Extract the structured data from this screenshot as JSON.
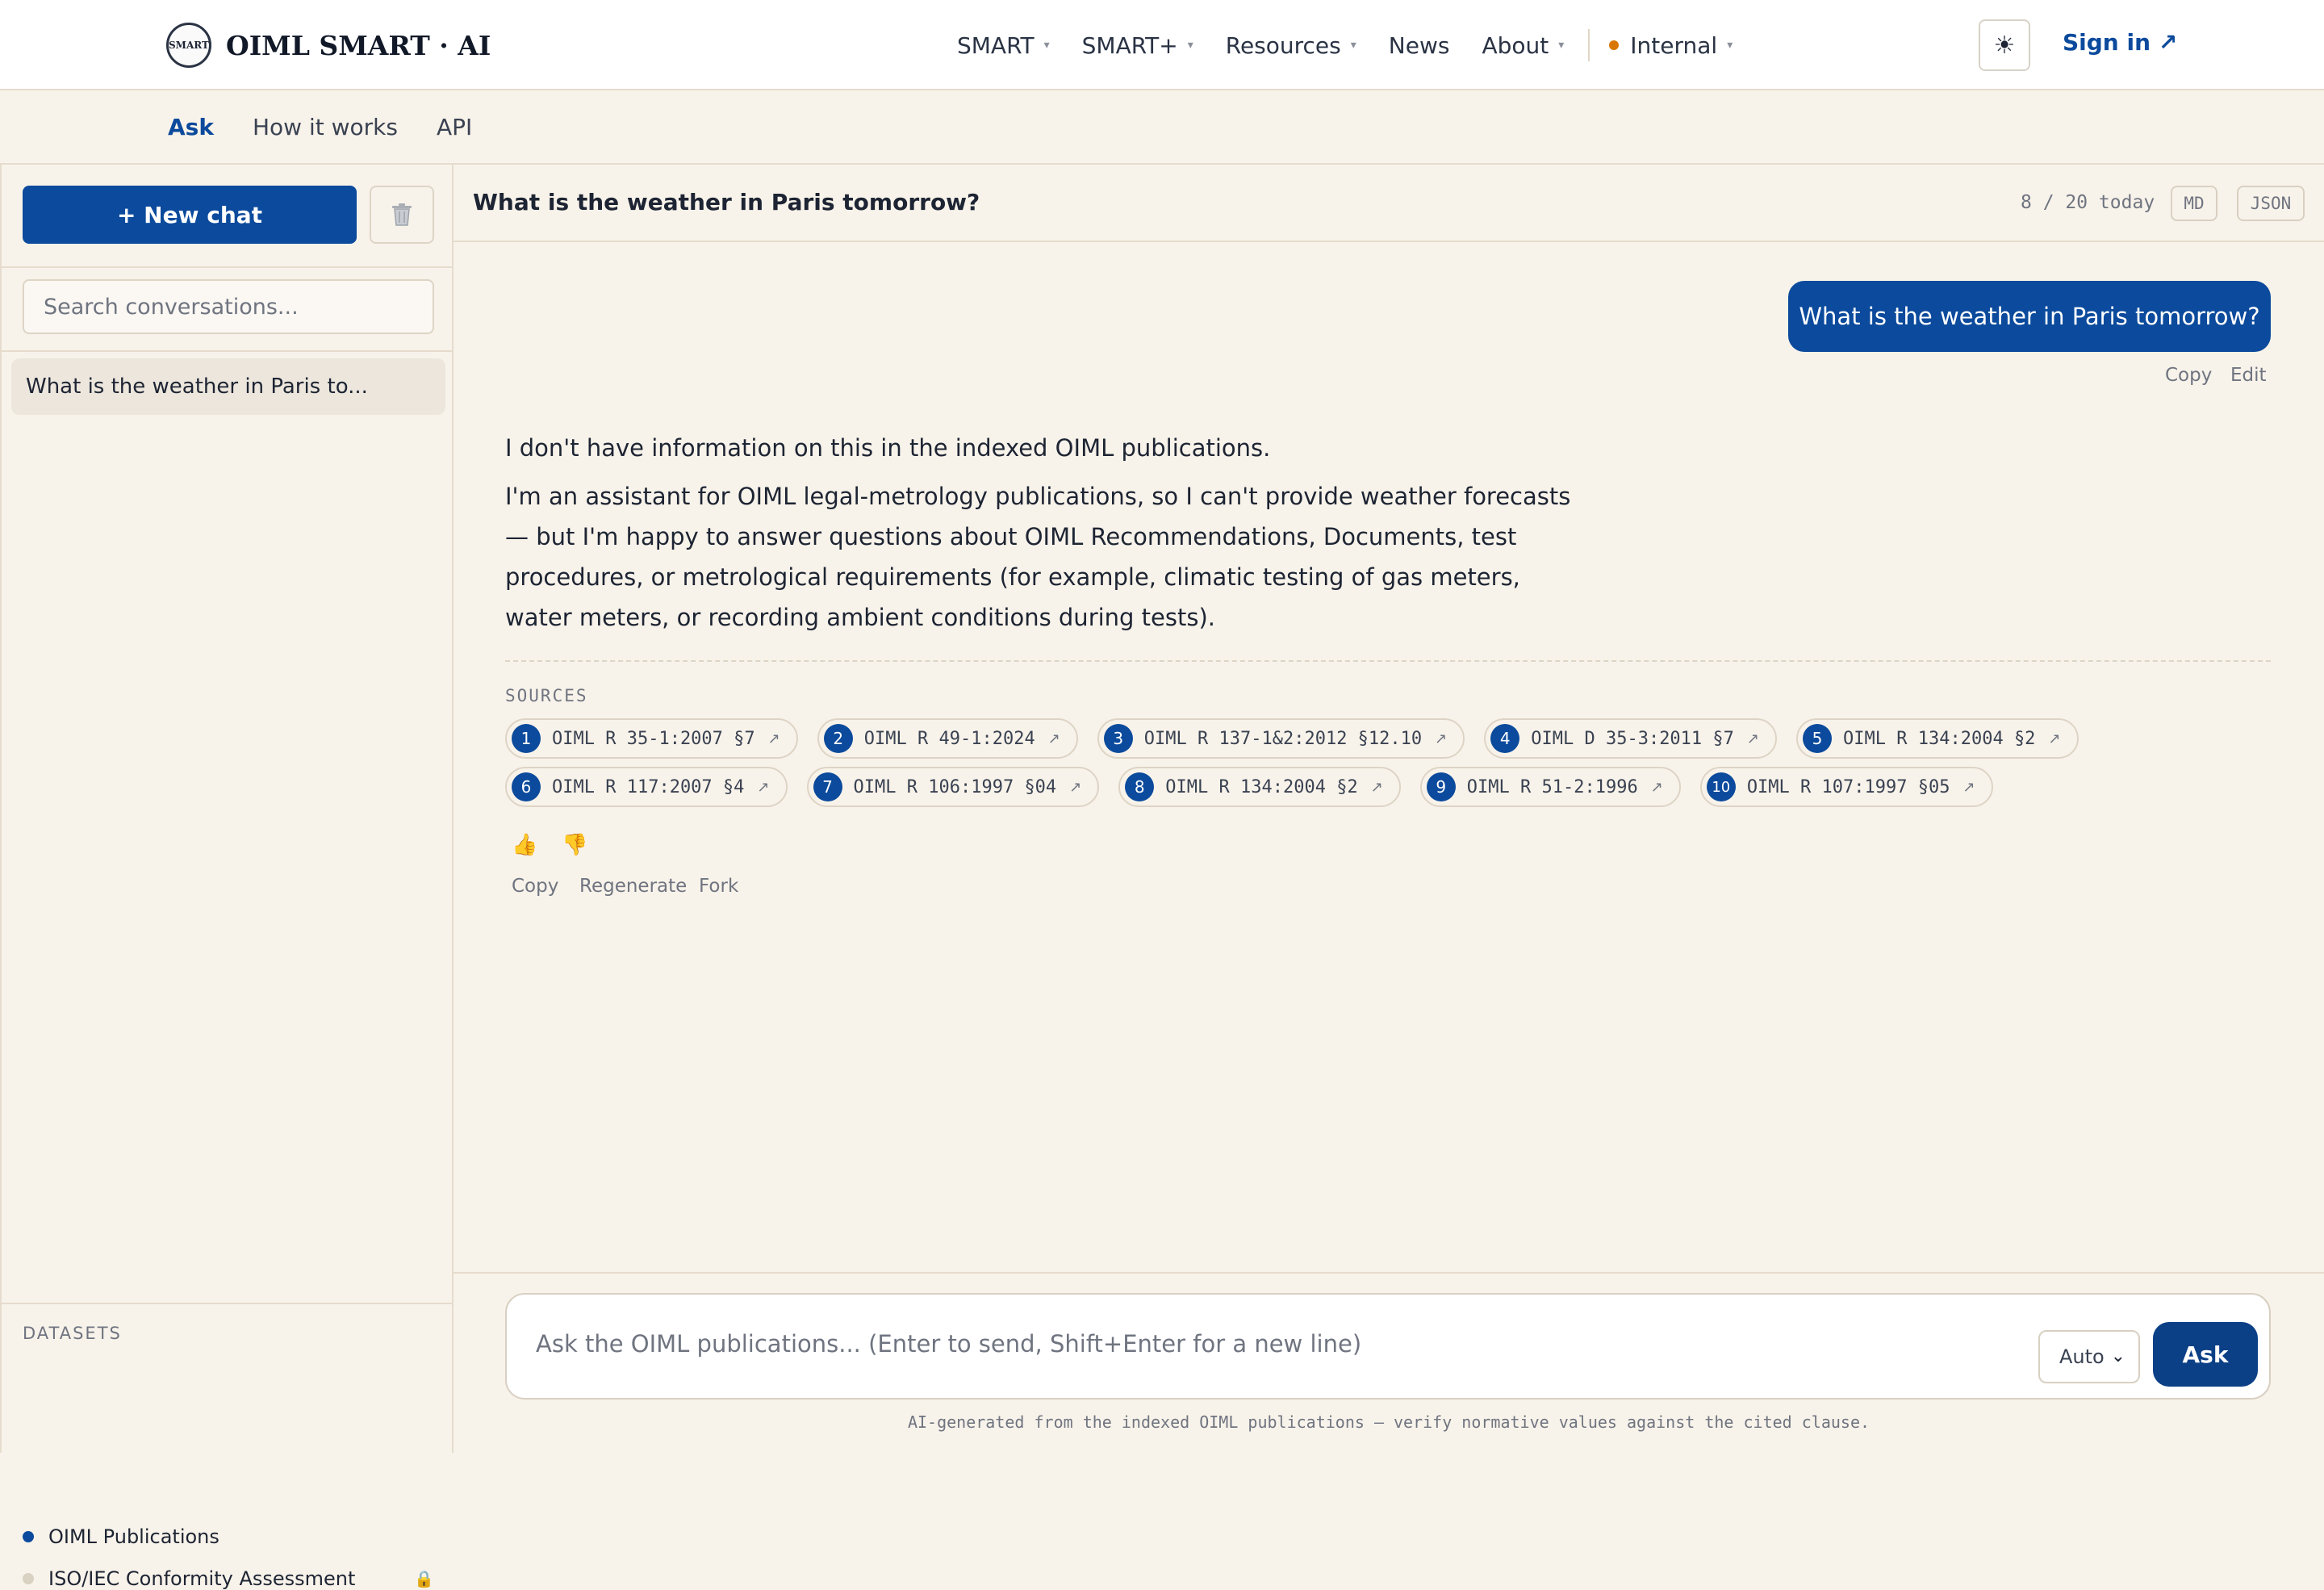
{
  "brand": {
    "logo_text": "SMART",
    "name": "OIML SMART · AI"
  },
  "nav": {
    "items": [
      {
        "label": "SMART",
        "has_caret": true
      },
      {
        "label": "SMART+",
        "has_caret": true
      },
      {
        "label": "Resources",
        "has_caret": true
      },
      {
        "label": "News",
        "has_caret": false
      },
      {
        "label": "About",
        "has_caret": true
      }
    ],
    "internal_label": "Internal",
    "theme_icon": "sun-icon",
    "sign_in": "Sign in ↗"
  },
  "subnav": {
    "tabs": [
      "Ask",
      "How it works",
      "API"
    ],
    "active": "Ask"
  },
  "sidebar": {
    "new_chat": "+ New chat",
    "search_placeholder": "Search conversations...",
    "conversations": [
      "What is the weather in Paris to..."
    ],
    "datasets_title": "DATASETS",
    "datasets": [
      {
        "name": "OIML Publications",
        "color": "#0b4a9c",
        "locked": false
      },
      {
        "name": "ISO/IEC Conformity Assessment",
        "color": "#d9d2c2",
        "locked": true
      }
    ]
  },
  "chat": {
    "title": "What is the weather in Paris tomorrow?",
    "quota": "8 / 20 today",
    "export_md": "MD",
    "export_json": "JSON",
    "user_message": "What is the weather in Paris tomorrow?",
    "user_actions": {
      "copy": "Copy",
      "edit": "Edit"
    },
    "answer_paragraphs": [
      "I don't have information on this in the indexed OIML publications.",
      "I'm an assistant for OIML legal-metrology publications, so I can't provide weather forecasts — but I'm happy to answer questions about OIML Recommendations, Documents, test procedures, or metrological requirements (for example, climatic testing of gas meters, water meters, or recording ambient conditions during tests)."
    ],
    "sources_title": "SOURCES",
    "sources": [
      {
        "n": "1",
        "label": "OIML R 35-1:2007 §7"
      },
      {
        "n": "2",
        "label": "OIML R 49-1:2024"
      },
      {
        "n": "3",
        "label": "OIML R 137-1&2:2012 §12.10"
      },
      {
        "n": "4",
        "label": "OIML D 35-3:2011 §7"
      },
      {
        "n": "5",
        "label": "OIML R 134:2004 §2"
      },
      {
        "n": "6",
        "label": "OIML R 117:2007 §4"
      },
      {
        "n": "7",
        "label": "OIML R 106:1997 §04"
      },
      {
        "n": "8",
        "label": "OIML R 134:2004 §2"
      },
      {
        "n": "9",
        "label": "OIML R 51-2:1996"
      },
      {
        "n": "10",
        "label": "OIML R 107:1997 §05"
      }
    ],
    "feedback": {
      "up": "👍",
      "down": "👎"
    },
    "answer_actions": {
      "copy": "Copy",
      "regenerate": "Regenerate",
      "fork": "Fork"
    }
  },
  "composer": {
    "placeholder": "Ask the OIML publications... (Enter to send, Shift+Enter for a new line)",
    "mode": "Auto",
    "ask": "Ask",
    "disclaimer": "AI-generated from the indexed OIML publications — verify normative values against the cited clause."
  },
  "colors": {
    "accent": "#0b4a9c",
    "background": "#f8f3ea",
    "internal_dot": "#d97706"
  }
}
